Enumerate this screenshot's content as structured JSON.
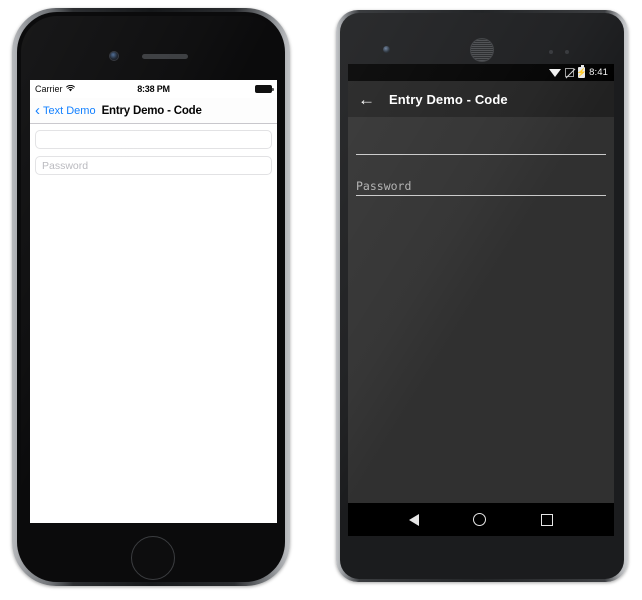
{
  "page": {
    "title": "Entry Demo - Code"
  },
  "ios": {
    "status_bar": {
      "carrier": "Carrier",
      "wifi_icon": "wifi-icon",
      "time": "8:38 PM",
      "battery_icon": "battery-full-icon"
    },
    "nav_bar": {
      "back_chevron_icon": "chevron-left-icon",
      "back_label": "Text Demo",
      "title": "Entry Demo - Code"
    },
    "form": {
      "entries": [
        {
          "name": "text-entry",
          "value": "",
          "placeholder": ""
        },
        {
          "name": "password-entry",
          "value": "",
          "placeholder": "Password"
        }
      ]
    },
    "hardware": {
      "camera_icon": "front-camera-icon",
      "speaker_icon": "earpiece-speaker-icon",
      "home_button_icon": "home-button-icon"
    },
    "colors": {
      "accent": "#0a7cff",
      "screen_background": "#ffffff",
      "navbar_background": "#fdfdfd",
      "placeholder_text": "#b8b8bd"
    }
  },
  "android": {
    "status_bar": {
      "wifi_icon": "wifi-icon",
      "signal_icon": "cellular-no-signal-icon",
      "battery_icon": "battery-charging-icon",
      "battery_glyph": "⚡",
      "time": "8:41"
    },
    "app_bar": {
      "back_icon": "arrow-left-icon",
      "back_glyph": "←",
      "title": "Entry Demo - Code"
    },
    "form": {
      "entries": [
        {
          "name": "text-entry",
          "value": "",
          "placeholder": ""
        },
        {
          "name": "password-entry",
          "value": "",
          "placeholder": "Password"
        }
      ]
    },
    "nav_bar": {
      "back_icon": "nav-back-triangle-icon",
      "home_icon": "nav-home-circle-icon",
      "recents_icon": "nav-recents-square-icon"
    },
    "hardware": {
      "camera_icon": "front-camera-icon",
      "speaker_icon": "earpiece-grille-icon",
      "sensor_icon": "proximity-sensor-icon"
    },
    "colors": {
      "appbar_background": "#212121",
      "screen_background": "#303030",
      "navbar_background": "#000000",
      "underline": "#c9c9c9",
      "placeholder_text": "#b0b0b0"
    }
  }
}
